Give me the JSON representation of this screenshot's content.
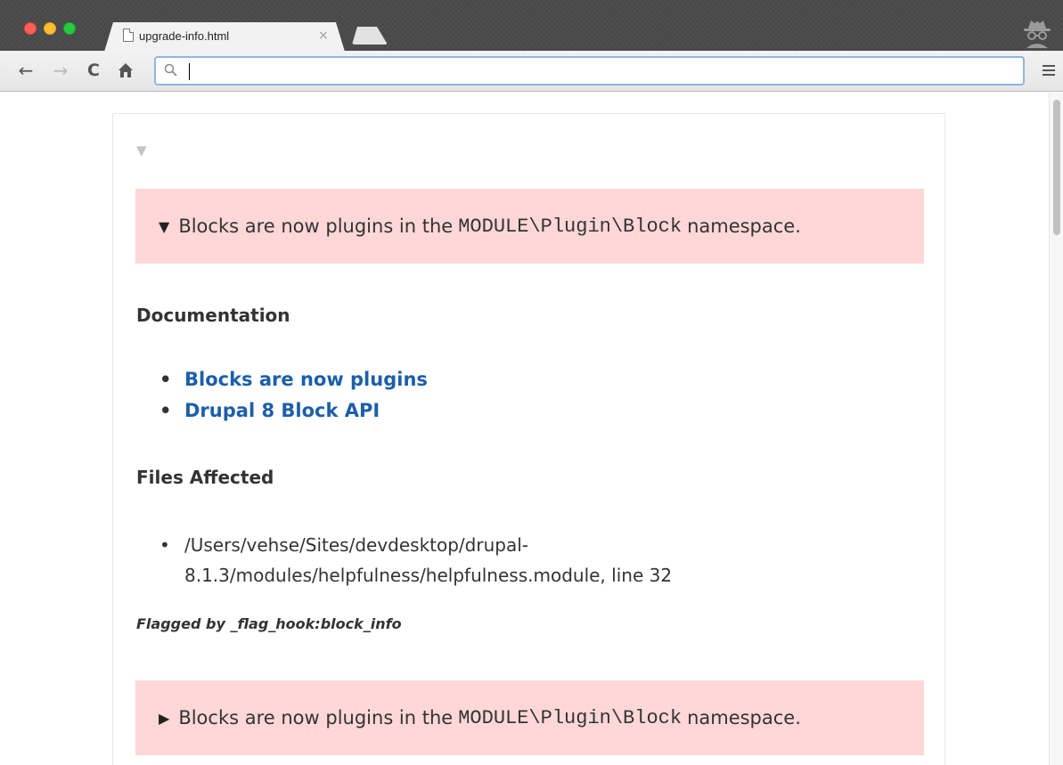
{
  "browser": {
    "tab_title": "upgrade-info.html",
    "tab_close": "×",
    "address_value": "",
    "icons": [
      "back-arrow-icon",
      "forward-arrow-icon",
      "reload-icon",
      "home-icon",
      "search-icon",
      "menu-icon",
      "incognito-icon"
    ]
  },
  "page": {
    "collapse_toggle": "▼",
    "notices": [
      {
        "arrow": "▼",
        "text_before": "Blocks are now plugins in the",
        "code": "MODULE\\Plugin\\Block",
        "text_after": "namespace."
      },
      {
        "arrow": "▶",
        "text_before": "Blocks are now plugins in the",
        "code": "MODULE\\Plugin\\Block",
        "text_after": "namespace."
      }
    ],
    "documentation_heading": "Documentation",
    "documentation_links": [
      "Blocks are now plugins",
      "Drupal 8 Block API"
    ],
    "files_heading": "Files Affected",
    "files": [
      "/Users/vehse/Sites/devdesktop/drupal-8.1.3/modules/helpfulness/helpfulness.module, line 32"
    ],
    "flagged_by": "Flagged by _flag_hook:block_info"
  },
  "colors": {
    "notice_bg": "#ffd7d7",
    "link": "#1c5fa8",
    "text": "#333333"
  }
}
